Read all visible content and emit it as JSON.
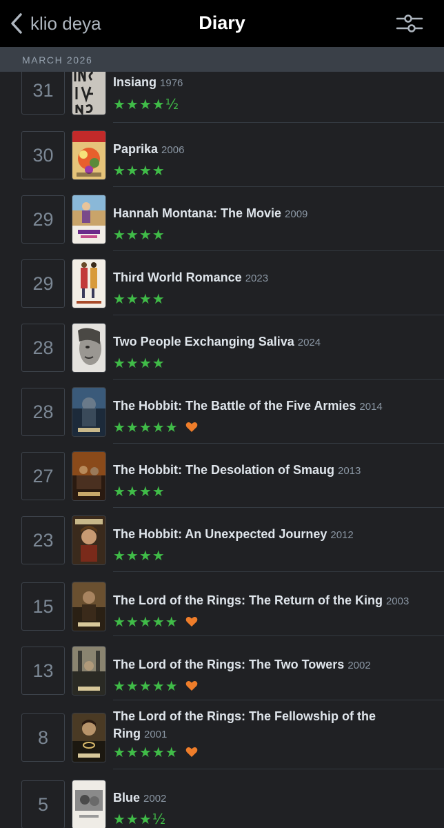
{
  "header": {
    "back_label": "klio deya",
    "title": "Diary"
  },
  "month_label": "MARCH 2026",
  "colors": {
    "star": "#40bc48",
    "heart": "#ee7d2a",
    "background": "#202124"
  },
  "entries": [
    {
      "day": "31",
      "title": "Insiang",
      "year": "1976",
      "stars": "★★★★½",
      "liked": false
    },
    {
      "day": "30",
      "title": "Paprika",
      "year": "2006",
      "stars": "★★★★",
      "liked": false
    },
    {
      "day": "29",
      "title": "Hannah Montana: The Movie",
      "year": "2009",
      "stars": "★★★★",
      "liked": false
    },
    {
      "day": "29",
      "title": "Third World Romance",
      "year": "2023",
      "stars": "★★★★",
      "liked": false
    },
    {
      "day": "28",
      "title": "Two People Exchanging Saliva",
      "year": "2024",
      "stars": "★★★★",
      "liked": false
    },
    {
      "day": "28",
      "title": "The Hobbit: The Battle of the Five Armies",
      "year": "2014",
      "stars": "★★★★★",
      "liked": true
    },
    {
      "day": "27",
      "title": "The Hobbit: The Desolation of Smaug",
      "year": "2013",
      "stars": "★★★★",
      "liked": false
    },
    {
      "day": "23",
      "title": "The Hobbit: An Unexpected Journey",
      "year": "2012",
      "stars": "★★★★",
      "liked": false
    },
    {
      "day": "15",
      "title": "The Lord of the Rings: The Return of the King",
      "year": "2003",
      "stars": "★★★★★",
      "liked": true
    },
    {
      "day": "13",
      "title": "The Lord of the Rings: The Two Towers",
      "year": "2002",
      "stars": "★★★★★",
      "liked": true
    },
    {
      "day": "8",
      "title": "The Lord of the Rings: The Fellowship of the Ring",
      "year": "2001",
      "stars": "★★★★★",
      "liked": true
    },
    {
      "day": "5",
      "title": "Blue",
      "year": "2002",
      "stars": "★★★½",
      "liked": false
    }
  ]
}
